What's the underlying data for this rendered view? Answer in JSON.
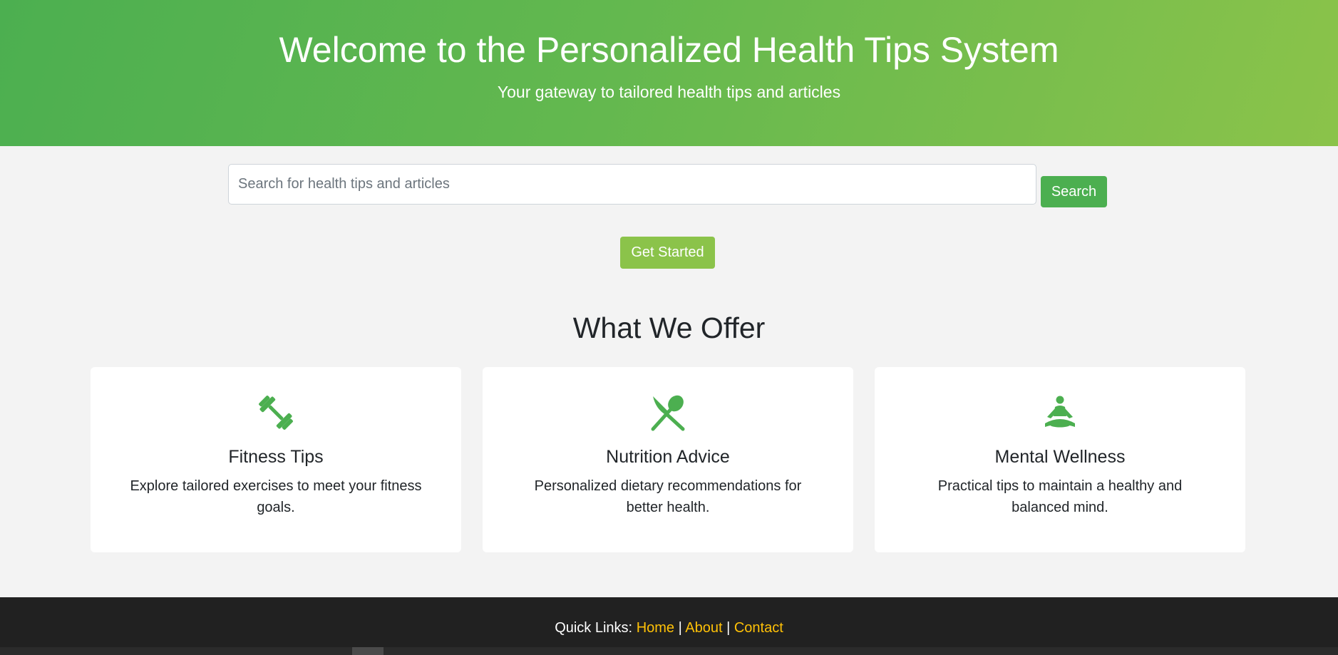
{
  "hero": {
    "title": "Welcome to the Personalized Health Tips System",
    "subtitle": "Your gateway to tailored health tips and articles"
  },
  "search": {
    "placeholder": "Search for health tips and articles",
    "value": "",
    "button_label": "Search"
  },
  "cta": {
    "label": "Get Started"
  },
  "offer": {
    "title": "What We Offer",
    "cards": [
      {
        "icon": "dumbbell-icon",
        "title": "Fitness Tips",
        "text": "Explore tailored exercises to meet your fitness goals."
      },
      {
        "icon": "utensils-icon",
        "title": "Nutrition Advice",
        "text": "Personalized dietary recommendations for better health."
      },
      {
        "icon": "meditation-icon",
        "title": "Mental Wellness",
        "text": "Practical tips to maintain a healthy and balanced mind."
      }
    ]
  },
  "footer": {
    "prefix": "Quick Links:",
    "links": [
      "Home",
      "About",
      "Contact"
    ],
    "separator": "|"
  },
  "colors": {
    "primary": "#4caf50",
    "secondary": "#8bc34a",
    "footer_bg": "#212121",
    "link": "#ffc107"
  }
}
